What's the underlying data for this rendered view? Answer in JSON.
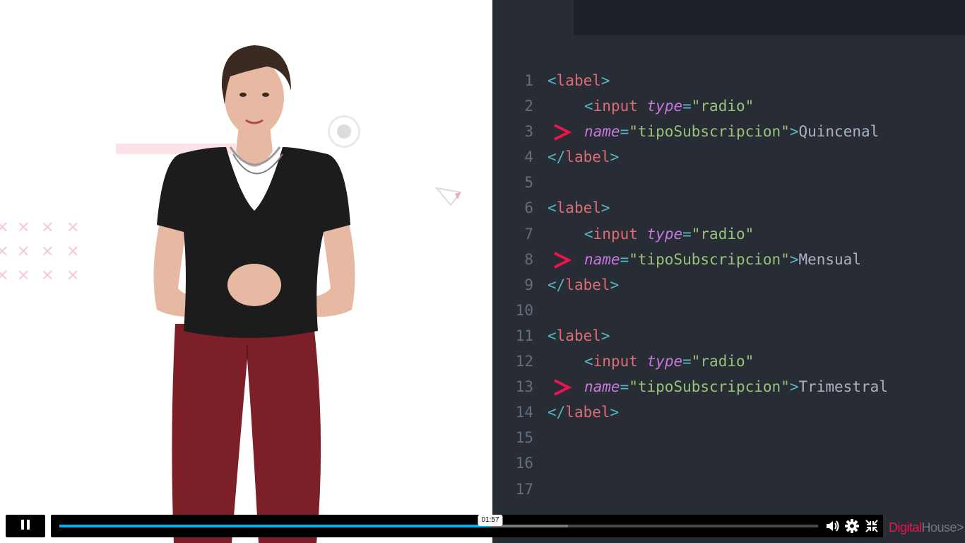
{
  "video": {
    "code_lines": [
      {
        "n": "1",
        "parts": [
          [
            "tag-br",
            "<"
          ],
          [
            "tag",
            "label"
          ],
          [
            "tag-br",
            ">"
          ]
        ]
      },
      {
        "n": "2",
        "indent": true,
        "parts": [
          [
            "tag-br",
            "<"
          ],
          [
            "tag",
            "input"
          ],
          [
            "txt",
            " "
          ],
          [
            "attr",
            "type"
          ],
          [
            "eq",
            "="
          ],
          [
            "str",
            "\"radio\""
          ]
        ]
      },
      {
        "n": "3",
        "indent": true,
        "arrow": true,
        "parts": [
          [
            "attr",
            "name"
          ],
          [
            "eq",
            "="
          ],
          [
            "str",
            "\"tipoSubscripcion\""
          ],
          [
            "tag-br",
            ">"
          ],
          [
            "txt",
            "Quincenal"
          ]
        ]
      },
      {
        "n": "4",
        "parts": [
          [
            "tag-br",
            "</"
          ],
          [
            "tag",
            "label"
          ],
          [
            "tag-br",
            ">"
          ]
        ]
      },
      {
        "n": "5",
        "parts": []
      },
      {
        "n": "6",
        "parts": [
          [
            "tag-br",
            "<"
          ],
          [
            "tag",
            "label"
          ],
          [
            "tag-br",
            ">"
          ]
        ]
      },
      {
        "n": "7",
        "indent": true,
        "parts": [
          [
            "tag-br",
            "<"
          ],
          [
            "tag",
            "input"
          ],
          [
            "txt",
            " "
          ],
          [
            "attr",
            "type"
          ],
          [
            "eq",
            "="
          ],
          [
            "str",
            "\"radio\""
          ]
        ]
      },
      {
        "n": "8",
        "indent": true,
        "arrow": true,
        "parts": [
          [
            "attr",
            "name"
          ],
          [
            "eq",
            "="
          ],
          [
            "str",
            "\"tipoSubscripcion\""
          ],
          [
            "tag-br",
            ">"
          ],
          [
            "txt",
            "Mensual"
          ]
        ]
      },
      {
        "n": "9",
        "parts": [
          [
            "tag-br",
            "</"
          ],
          [
            "tag",
            "label"
          ],
          [
            "tag-br",
            ">"
          ]
        ]
      },
      {
        "n": "10",
        "parts": []
      },
      {
        "n": "11",
        "parts": [
          [
            "tag-br",
            "<"
          ],
          [
            "tag",
            "label"
          ],
          [
            "tag-br",
            ">"
          ]
        ]
      },
      {
        "n": "12",
        "indent": true,
        "parts": [
          [
            "tag-br",
            "<"
          ],
          [
            "tag",
            "input"
          ],
          [
            "txt",
            " "
          ],
          [
            "attr",
            "type"
          ],
          [
            "eq",
            "="
          ],
          [
            "str",
            "\"radio\""
          ]
        ]
      },
      {
        "n": "13",
        "indent": true,
        "arrow": true,
        "parts": [
          [
            "attr",
            "name"
          ],
          [
            "eq",
            "="
          ],
          [
            "str",
            "\"tipoSubscripcion\""
          ],
          [
            "tag-br",
            ">"
          ],
          [
            "txt",
            "Trimestral"
          ]
        ]
      },
      {
        "n": "14",
        "parts": [
          [
            "tag-br",
            "</"
          ],
          [
            "tag",
            "label"
          ],
          [
            "tag-br",
            ">"
          ]
        ]
      },
      {
        "n": "15",
        "parts": []
      },
      {
        "n": "16",
        "parts": []
      },
      {
        "n": "17",
        "parts": []
      }
    ],
    "colors": {
      "code_bg": "#282c34",
      "tag": "#e06c75",
      "attribute": "#c678dd",
      "string": "#98c379",
      "bracket": "#56b6c2",
      "arrow": "#e8154f",
      "progress": "#00adef"
    }
  },
  "player": {
    "state": "playing",
    "play_icon": "pause-icon",
    "current_time": "01:57",
    "played_fraction": 0.568,
    "buffered_fraction": 0.67,
    "icons": [
      "volume-icon",
      "settings-gear-icon",
      "exit-fullscreen-icon"
    ]
  },
  "branding": {
    "logo_part1": "Digital",
    "logo_part2": "House>"
  }
}
